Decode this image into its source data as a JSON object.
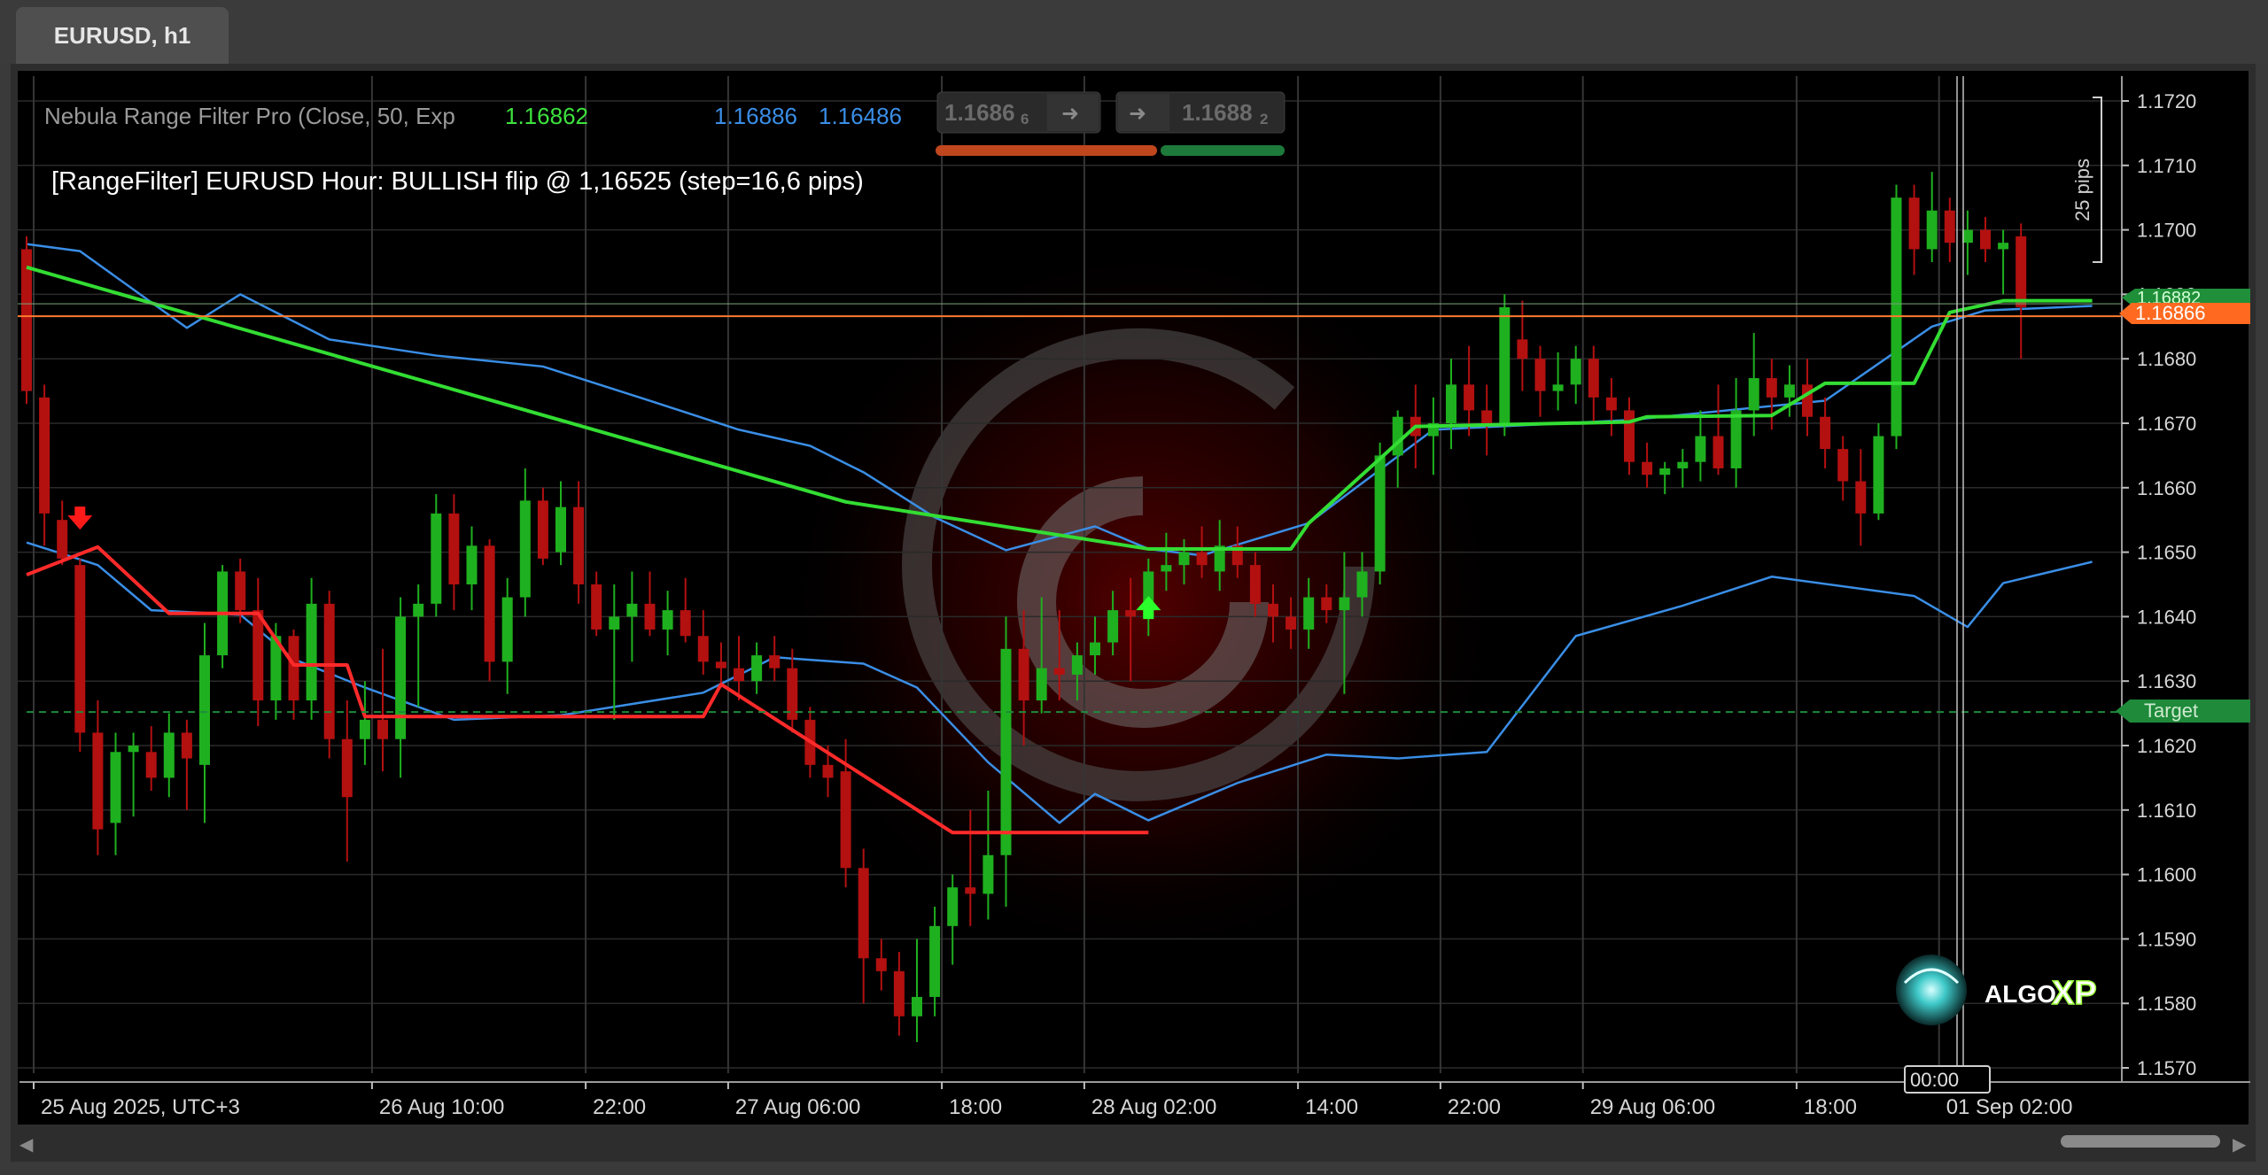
{
  "tab": {
    "label": "EURUSD, h1"
  },
  "indicator": {
    "name": "Nebula Range Filter Pro (Close, 50, Exp",
    "value1": "1.16862",
    "value2": "1.16886",
    "value3": "1.16486",
    "status": "[RangeFilter] EURUSD Hour: BULLISH flip @ 1,16525 (step=16,6 pips)"
  },
  "quote": {
    "bid": "1.1686",
    "bid_sub": "6",
    "ask": "1.1688",
    "ask_sub": "2",
    "arrow": "➜"
  },
  "ruler": {
    "label": "25 pips"
  },
  "price_tags": {
    "current": "1.16866",
    "behind": "1.16882",
    "target": "Target"
  },
  "clock": {
    "label": "00:00"
  },
  "logo": {
    "text_a": "ALGO",
    "text_b": "XP"
  },
  "colors": {
    "bull": "#1fb01f",
    "bear": "#b31010",
    "filter": "#33dd33",
    "filter_bear": "#ff2a2a",
    "band": "#3a8ee6",
    "price_line": "#ff7b2e",
    "target": "#1e8a3a"
  },
  "chart_data": {
    "type": "candlestick",
    "symbol": "EURUSD",
    "timeframe": "h1",
    "y_ticks": [
      "1.1720",
      "1.1710",
      "1.1700",
      "1.1690",
      "1.1680",
      "1.1670",
      "1.1660",
      "1.1650",
      "1.1640",
      "1.1630",
      "1.1620",
      "1.1610",
      "1.1600",
      "1.1590",
      "1.1580",
      "1.1570"
    ],
    "y_range": [
      1.15665,
      1.17225
    ],
    "x_labels": [
      {
        "label": "25 Aug 2025, UTC+3",
        "index": 0
      },
      {
        "label": "26 Aug 10:00",
        "index": 19
      },
      {
        "label": "22:00",
        "index": 31
      },
      {
        "label": "27 Aug 06:00",
        "index": 39
      },
      {
        "label": "18:00",
        "index": 51
      },
      {
        "label": "28 Aug 02:00",
        "index": 59
      },
      {
        "label": "14:00",
        "index": 71
      },
      {
        "label": "22:00",
        "index": 79
      },
      {
        "label": "29 Aug 06:00",
        "index": 87
      },
      {
        "label": "18:00",
        "index": 99
      },
      {
        "label": "01 Sep 02:00",
        "index": 107
      }
    ],
    "current_price": 1.16866,
    "target_price": 1.16252,
    "candles": [
      [
        1.1697,
        1.1699,
        1.1673,
        1.1675
      ],
      [
        1.1674,
        1.1676,
        1.1651,
        1.1656
      ],
      [
        1.1655,
        1.1658,
        1.1648,
        1.1649
      ],
      [
        1.1648,
        1.1649,
        1.1619,
        1.1622
      ],
      [
        1.1622,
        1.1627,
        1.1603,
        1.1607
      ],
      [
        1.1608,
        1.1622,
        1.1603,
        1.1619
      ],
      [
        1.1619,
        1.1622,
        1.1609,
        1.162
      ],
      [
        1.1619,
        1.1623,
        1.1613,
        1.1615
      ],
      [
        1.1615,
        1.1625,
        1.1612,
        1.1622
      ],
      [
        1.1622,
        1.1624,
        1.161,
        1.1618
      ],
      [
        1.1617,
        1.1639,
        1.1608,
        1.1634
      ],
      [
        1.1634,
        1.1648,
        1.1632,
        1.1647
      ],
      [
        1.1647,
        1.1649,
        1.1639,
        1.1641
      ],
      [
        1.1641,
        1.1646,
        1.1623,
        1.1627
      ],
      [
        1.1627,
        1.1639,
        1.1624,
        1.1637
      ],
      [
        1.1637,
        1.1638,
        1.1624,
        1.1627
      ],
      [
        1.1627,
        1.1646,
        1.1624,
        1.1642
      ],
      [
        1.1642,
        1.1644,
        1.1618,
        1.1621
      ],
      [
        1.1621,
        1.1627,
        1.1602,
        1.1612
      ],
      [
        1.1621,
        1.163,
        1.1617,
        1.1624
      ],
      [
        1.1624,
        1.1635,
        1.1616,
        1.1621
      ],
      [
        1.1621,
        1.1643,
        1.1615,
        1.164
      ],
      [
        1.164,
        1.1645,
        1.1626,
        1.1642
      ],
      [
        1.1642,
        1.1659,
        1.164,
        1.1656
      ],
      [
        1.1656,
        1.1659,
        1.1641,
        1.1645
      ],
      [
        1.1645,
        1.1654,
        1.1641,
        1.1651
      ],
      [
        1.1651,
        1.1652,
        1.163,
        1.1633
      ],
      [
        1.1633,
        1.1646,
        1.1628,
        1.1643
      ],
      [
        1.1643,
        1.1663,
        1.164,
        1.1658
      ],
      [
        1.1658,
        1.166,
        1.1648,
        1.1649
      ],
      [
        1.165,
        1.1661,
        1.1648,
        1.1657
      ],
      [
        1.1657,
        1.1661,
        1.1642,
        1.1645
      ],
      [
        1.1645,
        1.1647,
        1.1637,
        1.1638
      ],
      [
        1.1638,
        1.1645,
        1.1624,
        1.164
      ],
      [
        1.164,
        1.1647,
        1.1633,
        1.1642
      ],
      [
        1.1642,
        1.1647,
        1.1637,
        1.1638
      ],
      [
        1.1638,
        1.1644,
        1.1634,
        1.1641
      ],
      [
        1.1641,
        1.1646,
        1.1636,
        1.1637
      ],
      [
        1.1637,
        1.1641,
        1.1631,
        1.1633
      ],
      [
        1.1633,
        1.1636,
        1.1629,
        1.1632
      ],
      [
        1.1632,
        1.1637,
        1.1627,
        1.163
      ],
      [
        1.163,
        1.1636,
        1.1628,
        1.1634
      ],
      [
        1.1634,
        1.1637,
        1.163,
        1.1632
      ],
      [
        1.1632,
        1.1635,
        1.1622,
        1.1624
      ],
      [
        1.1624,
        1.1626,
        1.1615,
        1.1617
      ],
      [
        1.1617,
        1.162,
        1.1612,
        1.1615
      ],
      [
        1.1616,
        1.1621,
        1.1598,
        1.1601
      ],
      [
        1.1601,
        1.1604,
        1.158,
        1.1587
      ],
      [
        1.1587,
        1.159,
        1.1582,
        1.1585
      ],
      [
        1.1585,
        1.1588,
        1.1575,
        1.1578
      ],
      [
        1.1578,
        1.159,
        1.1574,
        1.1581
      ],
      [
        1.1581,
        1.1595,
        1.1578,
        1.1592
      ],
      [
        1.1592,
        1.16,
        1.1586,
        1.1598
      ],
      [
        1.1598,
        1.161,
        1.1592,
        1.1597
      ],
      [
        1.1597,
        1.1613,
        1.1593,
        1.1603
      ],
      [
        1.1603,
        1.164,
        1.1595,
        1.1635
      ],
      [
        1.1635,
        1.1641,
        1.162,
        1.1627
      ],
      [
        1.1627,
        1.1643,
        1.1625,
        1.1632
      ],
      [
        1.1632,
        1.1641,
        1.1627,
        1.1631
      ],
      [
        1.1631,
        1.1636,
        1.1627,
        1.1634
      ],
      [
        1.1634,
        1.164,
        1.1631,
        1.1636
      ],
      [
        1.1636,
        1.1644,
        1.1634,
        1.1641
      ],
      [
        1.1641,
        1.1646,
        1.163,
        1.164
      ],
      [
        1.164,
        1.1649,
        1.1637,
        1.1647
      ],
      [
        1.1647,
        1.1653,
        1.1644,
        1.1648
      ],
      [
        1.1648,
        1.1652,
        1.1645,
        1.165
      ],
      [
        1.165,
        1.1654,
        1.1646,
        1.1648
      ],
      [
        1.1647,
        1.1655,
        1.1644,
        1.1651
      ],
      [
        1.1651,
        1.1654,
        1.1646,
        1.1648
      ],
      [
        1.1648,
        1.165,
        1.164,
        1.1642
      ],
      [
        1.1642,
        1.1645,
        1.1636,
        1.164
      ],
      [
        1.164,
        1.1643,
        1.1635,
        1.1638
      ],
      [
        1.1638,
        1.1646,
        1.1635,
        1.1643
      ],
      [
        1.1643,
        1.1645,
        1.1639,
        1.1641
      ],
      [
        1.1641,
        1.165,
        1.1628,
        1.1643
      ],
      [
        1.1643,
        1.165,
        1.164,
        1.1647
      ],
      [
        1.1647,
        1.1667,
        1.1645,
        1.1665
      ],
      [
        1.1665,
        1.1672,
        1.166,
        1.1671
      ],
      [
        1.1671,
        1.1676,
        1.1663,
        1.1668
      ],
      [
        1.1668,
        1.1674,
        1.1662,
        1.167
      ],
      [
        1.167,
        1.168,
        1.1666,
        1.1676
      ],
      [
        1.1676,
        1.1682,
        1.1668,
        1.1672
      ],
      [
        1.1672,
        1.1676,
        1.1665,
        1.167
      ],
      [
        1.167,
        1.169,
        1.1668,
        1.1688
      ],
      [
        1.1688,
        1.1691,
        1.1683,
        1.1685
      ],
      [
        1.1685,
        1.1697,
        1.1682,
        1.1689
      ],
      [
        1.1689,
        1.169,
        1.1684,
        1.1686
      ],
      [
        1.1686,
        1.169,
        1.1679,
        1.1681
      ],
      [
        1.1681,
        1.1684,
        1.1676,
        1.1678
      ],
      [
        1.1678,
        1.168,
        1.1672,
        1.1674
      ]
    ],
    "candles_tail_start": 84,
    "candles_tail": [
      [
        1.1683,
        1.1689,
        1.1675,
        1.168
      ],
      [
        1.168,
        1.1682,
        1.1671,
        1.1675
      ],
      [
        1.1675,
        1.1681,
        1.1672,
        1.1676
      ],
      [
        1.1676,
        1.1682,
        1.1673,
        1.168
      ],
      [
        1.168,
        1.1682,
        1.167,
        1.1674
      ],
      [
        1.1674,
        1.1677,
        1.1668,
        1.1672
      ],
      [
        1.1672,
        1.1674,
        1.1662,
        1.1664
      ],
      [
        1.1664,
        1.1667,
        1.166,
        1.1662
      ],
      [
        1.1662,
        1.1664,
        1.1659,
        1.1663
      ],
      [
        1.1663,
        1.1666,
        1.166,
        1.1664
      ],
      [
        1.1664,
        1.1672,
        1.1661,
        1.1668
      ],
      [
        1.1668,
        1.1676,
        1.1662,
        1.1663
      ],
      [
        1.1663,
        1.1677,
        1.166,
        1.1672
      ],
      [
        1.1672,
        1.1684,
        1.1668,
        1.1677
      ],
      [
        1.1677,
        1.168,
        1.1669,
        1.1674
      ],
      [
        1.1674,
        1.1679,
        1.1671,
        1.1676
      ],
      [
        1.1676,
        1.168,
        1.1668,
        1.1671
      ],
      [
        1.1671,
        1.1674,
        1.1663,
        1.1666
      ],
      [
        1.1666,
        1.1668,
        1.1658,
        1.1661
      ],
      [
        1.1661,
        1.1666,
        1.1651,
        1.1656
      ],
      [
        1.1656,
        1.167,
        1.1655,
        1.1668
      ],
      [
        1.1668,
        1.1707,
        1.1666,
        1.1705
      ],
      [
        1.1705,
        1.1707,
        1.1693,
        1.1697
      ],
      [
        1.1697,
        1.1709,
        1.1695,
        1.1703
      ],
      [
        1.1703,
        1.1705,
        1.1695,
        1.1698
      ],
      [
        1.1698,
        1.1703,
        1.1693,
        1.17
      ],
      [
        1.17,
        1.1702,
        1.1695,
        1.1697
      ],
      [
        1.1697,
        1.17,
        1.169,
        1.1698
      ],
      [
        1.1699,
        1.1701,
        1.168,
        1.1688
      ]
    ],
    "filter_points": [
      [
        0,
        1.16942
      ],
      [
        46,
        1.16578
      ],
      [
        63,
        1.16505
      ],
      [
        71,
        1.16505
      ],
      [
        72,
        1.16545
      ],
      [
        78,
        1.16695
      ],
      [
        90,
        1.16702
      ],
      [
        91,
        1.1671
      ],
      [
        98,
        1.16712
      ],
      [
        101,
        1.16762
      ],
      [
        106,
        1.16762
      ],
      [
        108,
        1.16872
      ],
      [
        111,
        1.1689
      ],
      [
        116,
        1.1689
      ]
    ],
    "filter_bear_points": [
      [
        0,
        1.16465
      ],
      [
        4,
        1.16508
      ],
      [
        8,
        1.16405
      ],
      [
        13,
        1.16405
      ],
      [
        15,
        1.16325
      ],
      [
        16,
        1.16325
      ],
      [
        18,
        1.16325
      ],
      [
        19,
        1.16245
      ],
      [
        34,
        1.16245
      ],
      [
        38,
        1.16245
      ],
      [
        39,
        1.16295
      ],
      [
        52,
        1.16065
      ],
      [
        63,
        1.16065
      ]
    ],
    "band_upper": [
      [
        0,
        1.16978
      ],
      [
        3,
        1.16967
      ],
      [
        9,
        1.16848
      ],
      [
        12,
        1.169
      ],
      [
        17,
        1.1683
      ],
      [
        23,
        1.16805
      ],
      [
        29,
        1.16788
      ],
      [
        35,
        1.16735
      ],
      [
        40,
        1.1669
      ],
      [
        44,
        1.16665
      ],
      [
        47,
        1.16624
      ],
      [
        51,
        1.16554
      ],
      [
        55,
        1.16503
      ],
      [
        60,
        1.1654
      ],
      [
        63,
        1.16505
      ],
      [
        66,
        1.16495
      ],
      [
        72,
        1.16545
      ],
      [
        79,
        1.1669
      ],
      [
        90,
        1.16705
      ],
      [
        101,
        1.16735
      ],
      [
        107,
        1.1685
      ],
      [
        110,
        1.16875
      ],
      [
        116,
        1.16882
      ]
    ],
    "band_lower": [
      [
        0,
        1.16515
      ],
      [
        4,
        1.1648
      ],
      [
        7,
        1.1641
      ],
      [
        12,
        1.16403
      ],
      [
        15,
        1.16334
      ],
      [
        19,
        1.1629
      ],
      [
        24,
        1.1624
      ],
      [
        30,
        1.16247
      ],
      [
        38,
        1.16282
      ],
      [
        42,
        1.16337
      ],
      [
        47,
        1.16327
      ],
      [
        50,
        1.1629
      ],
      [
        54,
        1.16174
      ],
      [
        58,
        1.1608
      ],
      [
        60,
        1.16125
      ],
      [
        63,
        1.16084
      ],
      [
        68,
        1.16142
      ],
      [
        73,
        1.16186
      ],
      [
        77,
        1.1618
      ],
      [
        82,
        1.1619
      ],
      [
        87,
        1.1637
      ],
      [
        93,
        1.16417
      ],
      [
        98,
        1.16462
      ],
      [
        106,
        1.16432
      ],
      [
        109,
        1.16384
      ],
      [
        111,
        1.16452
      ],
      [
        116,
        1.16485
      ]
    ],
    "signals": [
      {
        "index": 3,
        "type": "down",
        "price": 1.16535
      },
      {
        "index": 63,
        "type": "up",
        "price": 1.16432
      }
    ]
  }
}
